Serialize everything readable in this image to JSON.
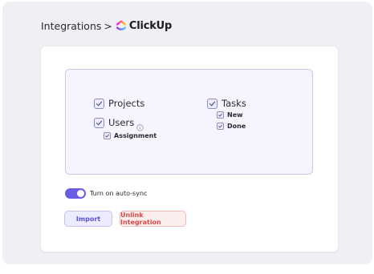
{
  "breadcrumb": {
    "root": "Integrations",
    "separator": ">",
    "brand": "ClickUp"
  },
  "permissions": {
    "projects": {
      "label": "Projects",
      "checked": true
    },
    "users": {
      "label": "Users",
      "checked": true
    },
    "assignment": {
      "label": "Assignment",
      "checked": true
    },
    "tasks": {
      "label": "Tasks",
      "checked": true
    },
    "new": {
      "label": "New",
      "checked": true
    },
    "done": {
      "label": "Done",
      "checked": true
    }
  },
  "autosync": {
    "label": "Turn on auto-sync",
    "enabled": true
  },
  "actions": {
    "import_label": "Import",
    "unlink_label": "Unlink Integration"
  },
  "colors": {
    "accent": "#6b5ce7",
    "danger": "#d94a4a"
  },
  "icons": {
    "brand": "clickup-logo-icon",
    "info": "info-icon",
    "check": "checkmark-icon"
  }
}
